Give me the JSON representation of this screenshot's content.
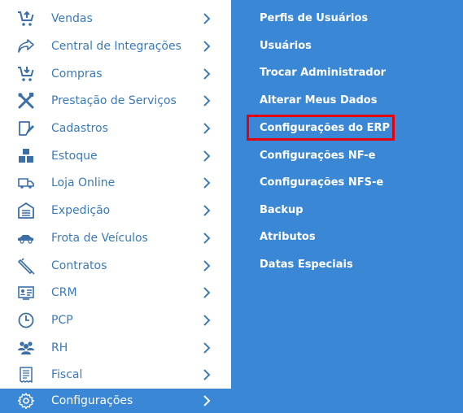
{
  "sidebar": {
    "items": [
      {
        "label": "Vendas",
        "icon": "cart-up-icon"
      },
      {
        "label": "Central de Integrações",
        "icon": "share-arrow-icon"
      },
      {
        "label": "Compras",
        "icon": "cart-down-icon"
      },
      {
        "label": "Prestação de Serviços",
        "icon": "tools-icon"
      },
      {
        "label": "Cadastros",
        "icon": "edit-form-icon"
      },
      {
        "label": "Estoque",
        "icon": "boxes-icon"
      },
      {
        "label": "Loja Online",
        "icon": "delivery-truck-icon"
      },
      {
        "label": "Expedição",
        "icon": "warehouse-icon"
      },
      {
        "label": "Frota de Veículos",
        "icon": "car-icon"
      },
      {
        "label": "Contratos",
        "icon": "pen-icon"
      },
      {
        "label": "CRM",
        "icon": "contact-card-icon"
      },
      {
        "label": "PCP",
        "icon": "clock-icon"
      },
      {
        "label": "RH",
        "icon": "people-icon"
      },
      {
        "label": "Fiscal",
        "icon": "document-icon"
      },
      {
        "label": "Configurações",
        "icon": "gear-icon",
        "active": true
      }
    ]
  },
  "submenu": {
    "items": [
      {
        "label": "Perfis de Usuários"
      },
      {
        "label": "Usuários"
      },
      {
        "label": "Trocar Administrador"
      },
      {
        "label": "Alterar Meus Dados"
      },
      {
        "label": "Configurações do ERP",
        "highlighted": true
      },
      {
        "label": "Configurações NF-e"
      },
      {
        "label": "Configurações NFS-e"
      },
      {
        "label": "Backup"
      },
      {
        "label": "Atributos"
      },
      {
        "label": "Datas Especiais"
      }
    ]
  },
  "colors": {
    "accent": "#3a87d6",
    "label_text": "#3a7ab8",
    "icon": "#3c6fa8",
    "chevron": "#3a7ab8",
    "highlight_border": "#e3000f"
  }
}
